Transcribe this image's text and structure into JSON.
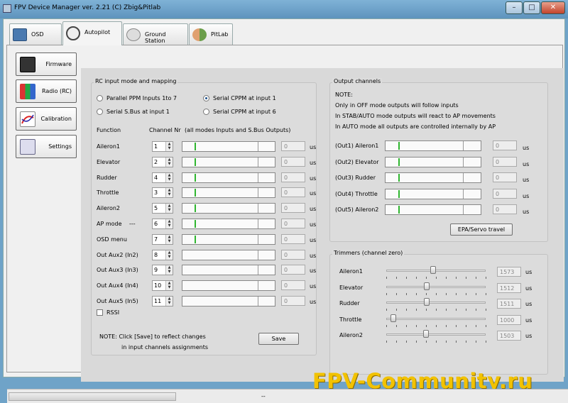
{
  "window": {
    "title": "FPV Device Manager ver. 2.21  (C) Zbig&Pitlab",
    "minimize": "–",
    "maximize": "□",
    "close": "✕"
  },
  "tabs": [
    {
      "label": "OSD",
      "icon": "osd-icon"
    },
    {
      "label": "Autopilot",
      "icon": "steering-wheel-icon"
    },
    {
      "label": "Ground Station",
      "icon": "antenna-icon"
    },
    {
      "label": "PitLab",
      "icon": "people-icon"
    }
  ],
  "nav": [
    {
      "label": "Firmware",
      "icon": "chip-icon"
    },
    {
      "label": "Radio (RC)",
      "icon": "bar-graph-icon"
    },
    {
      "label": "Calibration",
      "icon": "curve-icon"
    },
    {
      "label": "Settings",
      "icon": "settings-icon"
    }
  ],
  "rc": {
    "title": "RC input mode and mapping",
    "modes": [
      {
        "label": "Parallel PPM Inputs 1to 7",
        "selected": false
      },
      {
        "label": "Serial S.Bus at input 1",
        "selected": false
      },
      {
        "label": "Serial CPPM at input 1",
        "selected": true
      },
      {
        "label": "Serial CPPM at input 6",
        "selected": false
      }
    ],
    "header_function": "Function",
    "header_channel": "Channel Nr",
    "header_note": "(all modes Inputs and S.Bus Outputs)",
    "rows": [
      {
        "function": "Aileron1",
        "channel": "1",
        "value": "0",
        "unit": "us",
        "level": 0.13
      },
      {
        "function": "Elevator",
        "channel": "2",
        "value": "0",
        "unit": "us",
        "level": 0.13
      },
      {
        "function": "Rudder",
        "channel": "4",
        "value": "0",
        "unit": "us",
        "level": 0.13
      },
      {
        "function": "Throttle",
        "channel": "3",
        "value": "0",
        "unit": "us",
        "level": 0.13
      },
      {
        "function": "Aileron2",
        "channel": "5",
        "value": "0",
        "unit": "us",
        "level": 0.13
      },
      {
        "function": "AP mode",
        "channel": "6",
        "value": "0",
        "unit": "us",
        "level": 0.13,
        "extra": "---"
      },
      {
        "function": "OSD menu",
        "channel": "7",
        "value": "0",
        "unit": "us",
        "level": 0.13
      },
      {
        "function": "Out Aux2 (In2)",
        "channel": "8",
        "value": "0",
        "unit": "us",
        "level": null
      },
      {
        "function": "Out Aux3 (In3)",
        "channel": "9",
        "value": "0",
        "unit": "us",
        "level": null
      },
      {
        "function": "Out Aux4 (In4)",
        "channel": "10",
        "value": "0",
        "unit": "us",
        "level": null
      },
      {
        "function": "Out Aux5 (In5)",
        "channel": "11",
        "value": "0",
        "unit": "us",
        "level": null
      }
    ],
    "rssi_label": "RSSI",
    "note_line1": "NOTE:   Click [Save] to reflect changes",
    "note_line2": "in  input channels assignments",
    "save_label": "Save"
  },
  "output": {
    "title": "Output channels",
    "notes": [
      "NOTE:",
      "Only in OFF mode outputs will follow inputs",
      "In STAB/AUTO mode outputs will react to AP movements",
      "In AUTO mode all outputs are controlled internally by AP"
    ],
    "rows": [
      {
        "label": "(Out1) Aileron1",
        "value": "0",
        "unit": "us",
        "level": 0.13
      },
      {
        "label": "(Out2) Elevator",
        "value": "0",
        "unit": "us",
        "level": 0.13
      },
      {
        "label": "(Out3) Rudder",
        "value": "0",
        "unit": "us",
        "level": 0.13
      },
      {
        "label": "(Out4) Throttle",
        "value": "0",
        "unit": "us",
        "level": 0.13
      },
      {
        "label": "(Out5) Aileron2",
        "value": "0",
        "unit": "us",
        "level": 0.13
      }
    ],
    "epa_label": "EPA/Servo travel"
  },
  "trimmers": {
    "title": "Trimmers (channel zero)",
    "rows": [
      {
        "label": "Aileron1",
        "value": "1573",
        "unit": "us",
        "position": 0.47
      },
      {
        "label": "Elevator",
        "value": "1512",
        "unit": "us",
        "position": 0.41
      },
      {
        "label": "Rudder",
        "value": "1511",
        "unit": "us",
        "position": 0.41
      },
      {
        "label": "Throttle",
        "value": "1000",
        "unit": "us",
        "position": 0.07
      },
      {
        "label": "Aileron2",
        "value": "1503",
        "unit": "us",
        "position": 0.4
      }
    ]
  },
  "status": {
    "text": "--"
  },
  "watermark": "FPV-Community.ru"
}
